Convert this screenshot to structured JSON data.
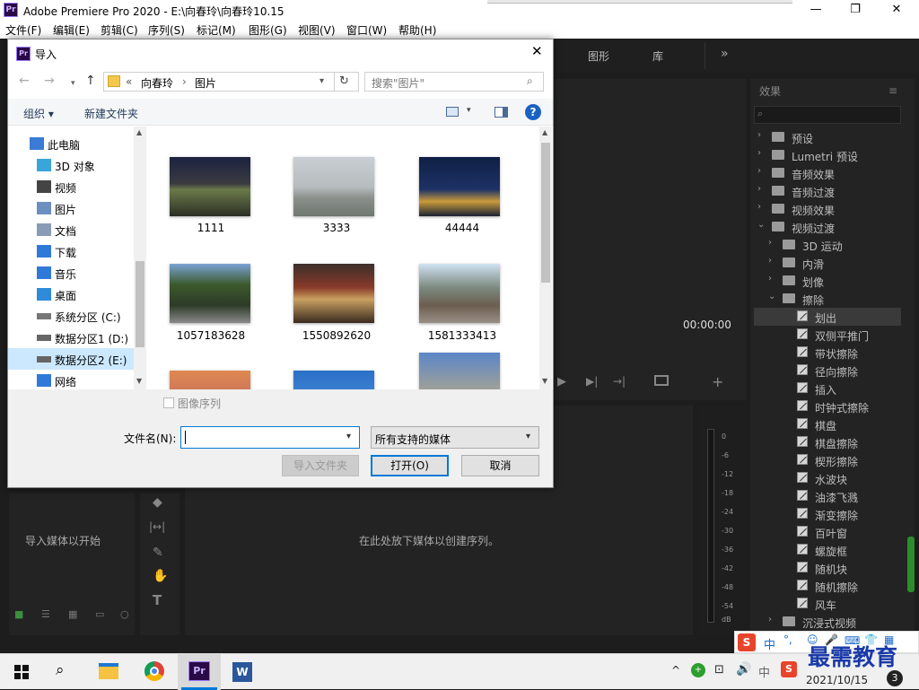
{
  "app": {
    "title": "Adobe Premiere Pro 2020 - E:\\向春玲\\向春玲10.15",
    "logo_text": "Pr",
    "menu": [
      "文件(F)",
      "编辑(E)",
      "剪辑(C)",
      "序列(S)",
      "标记(M)",
      "图形(G)",
      "视图(V)",
      "窗口(W)",
      "帮助(H)"
    ],
    "window_controls": [
      "—",
      "❐",
      "✕"
    ]
  },
  "workspace_tabs": [
    "图形",
    "库"
  ],
  "workspace_more": "»",
  "program_monitor": {
    "timecode": "00:00:00"
  },
  "project_panel": {
    "empty_text": "导入媒体以开始"
  },
  "timeline": {
    "empty_text": "在此处放下媒体以创建序列。"
  },
  "audio_meter": {
    "ticks": [
      "0",
      "-6",
      "-12",
      "-18",
      "-24",
      "-30",
      "-36",
      "-42",
      "-48",
      "-54",
      "dB"
    ]
  },
  "effects_panel": {
    "title": "效果",
    "menu_icon": "≡",
    "items": [
      {
        "label": "预设",
        "level": 0,
        "expanded": false,
        "type": "folder-star"
      },
      {
        "label": "Lumetri 预设",
        "level": 0,
        "expanded": false,
        "type": "folder-star"
      },
      {
        "label": "音频效果",
        "level": 0,
        "expanded": false,
        "type": "folder"
      },
      {
        "label": "音频过渡",
        "level": 0,
        "expanded": false,
        "type": "folder"
      },
      {
        "label": "视频效果",
        "level": 0,
        "expanded": false,
        "type": "folder"
      },
      {
        "label": "视频过渡",
        "level": 0,
        "expanded": true,
        "type": "folder"
      },
      {
        "label": "3D 运动",
        "level": 1,
        "expanded": false,
        "type": "folder"
      },
      {
        "label": "内滑",
        "level": 1,
        "expanded": false,
        "type": "folder"
      },
      {
        "label": "划像",
        "level": 1,
        "expanded": false,
        "type": "folder"
      },
      {
        "label": "擦除",
        "level": 1,
        "expanded": true,
        "type": "folder"
      },
      {
        "label": "划出",
        "level": 2,
        "type": "effect",
        "selected": true
      },
      {
        "label": "双侧平推门",
        "level": 2,
        "type": "effect"
      },
      {
        "label": "带状擦除",
        "level": 2,
        "type": "effect"
      },
      {
        "label": "径向擦除",
        "level": 2,
        "type": "effect"
      },
      {
        "label": "插入",
        "level": 2,
        "type": "effect"
      },
      {
        "label": "时钟式擦除",
        "level": 2,
        "type": "effect"
      },
      {
        "label": "棋盘",
        "level": 2,
        "type": "effect"
      },
      {
        "label": "棋盘擦除",
        "level": 2,
        "type": "effect"
      },
      {
        "label": "楔形擦除",
        "level": 2,
        "type": "effect"
      },
      {
        "label": "水波块",
        "level": 2,
        "type": "effect"
      },
      {
        "label": "油漆飞溅",
        "level": 2,
        "type": "effect"
      },
      {
        "label": "渐变擦除",
        "level": 2,
        "type": "effect"
      },
      {
        "label": "百叶窗",
        "level": 2,
        "type": "effect"
      },
      {
        "label": "螺旋框",
        "level": 2,
        "type": "effect"
      },
      {
        "label": "随机块",
        "level": 2,
        "type": "effect"
      },
      {
        "label": "随机擦除",
        "level": 2,
        "type": "effect"
      },
      {
        "label": "风车",
        "level": 2,
        "type": "effect"
      },
      {
        "label": "沉浸式视频",
        "level": 1,
        "expanded": false,
        "type": "folder"
      }
    ]
  },
  "import_dialog": {
    "title": "导入",
    "breadcrumb": [
      "«",
      "向春玲",
      "图片"
    ],
    "search_placeholder": "搜索\"图片\"",
    "toolbar": {
      "organize": "组织 ▾",
      "new_folder": "新建文件夹",
      "help": "?"
    },
    "nav": [
      {
        "label": "此电脑",
        "icon": "computer-icon"
      },
      {
        "label": "3D 对象",
        "icon": "cube-icon"
      },
      {
        "label": "视频",
        "icon": "video-icon"
      },
      {
        "label": "图片",
        "icon": "picture-icon"
      },
      {
        "label": "文档",
        "icon": "document-icon"
      },
      {
        "label": "下载",
        "icon": "download-icon"
      },
      {
        "label": "音乐",
        "icon": "music-icon"
      },
      {
        "label": "桌面",
        "icon": "desktop-icon"
      },
      {
        "label": "系统分区 (C:)",
        "icon": "system-drive-icon"
      },
      {
        "label": "数据分区1 (D:)",
        "icon": "drive-icon"
      },
      {
        "label": "数据分区2 (E:)",
        "icon": "drive-icon",
        "selected": true
      },
      {
        "label": "网络",
        "icon": "network-icon"
      }
    ],
    "files": [
      {
        "name": "1111"
      },
      {
        "name": "3333"
      },
      {
        "name": "44444"
      },
      {
        "name": "1057183628"
      },
      {
        "name": "1550892620"
      },
      {
        "name": "1581333413"
      },
      {
        "name": ""
      },
      {
        "name": ""
      },
      {
        "name": ""
      }
    ],
    "image_sequence_label": "图像序列",
    "filename_label": "文件名(N):",
    "filename_value": "",
    "filetype_value": "所有支持的媒体",
    "buttons": {
      "import_folder": "导入文件夹",
      "open": "打开(O)",
      "cancel": "取消"
    }
  },
  "taskbar": {
    "ime": "中",
    "datetime": "2021/10/15",
    "badge": "3",
    "watermark": "最需教育"
  }
}
